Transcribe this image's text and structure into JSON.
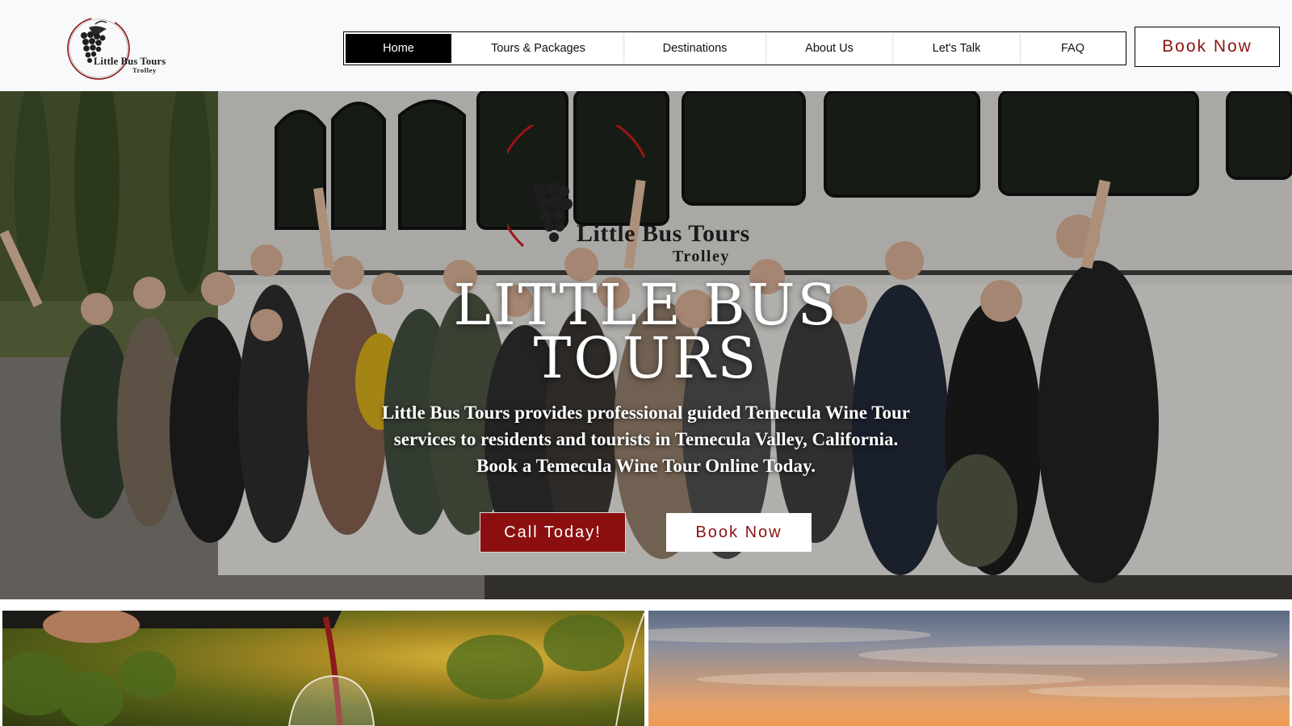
{
  "header": {
    "logo": {
      "line1": "Little Bus Tours",
      "line2": "Trolley"
    },
    "nav": [
      {
        "label": "Home",
        "active": true
      },
      {
        "label": "Tours & Packages",
        "active": false
      },
      {
        "label": "Destinations",
        "active": false
      },
      {
        "label": "About Us",
        "active": false
      },
      {
        "label": "Let's Talk",
        "active": false
      },
      {
        "label": "FAQ",
        "active": false
      }
    ],
    "book_button": "Book Now"
  },
  "hero": {
    "watermark_line1": "Little Bus Tours",
    "watermark_line2": "Trolley",
    "title_line1": "LITTLE BUS",
    "title_line2": "TOURS",
    "subtitle_lines": [
      "Little Bus Tours provides professional guided Temecula Wine Tour",
      "services to residents and tourists in Temecula Valley, California.",
      "Book a Temecula Wine Tour Online Today."
    ],
    "call_button": "Call Today!",
    "book_button": "Book Now"
  },
  "colors": {
    "brand_red": "#8c0f0f",
    "nav_active_bg": "#000000",
    "header_bg": "#f8f9fa"
  },
  "icons": {
    "logo": "grape-cluster-icon"
  }
}
